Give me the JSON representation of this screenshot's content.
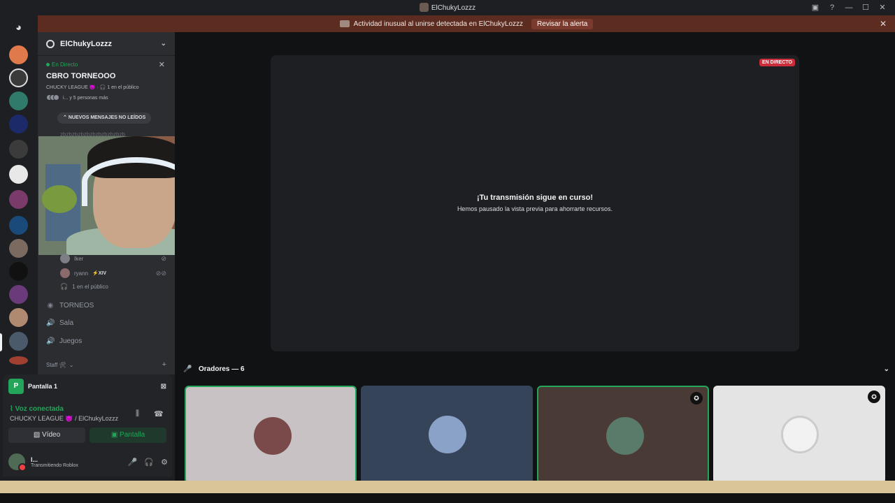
{
  "window": {
    "title": "ElChukyLozzz"
  },
  "alert": {
    "text": "Actividad inusual al unirse detectada en ElChukyLozzz",
    "button": "Revisar la alerta"
  },
  "server": {
    "name": "ElChukyLozzz"
  },
  "stage_card": {
    "live_label": "En Directo",
    "title": "CBRO TORNEOOO",
    "meta": "CHUCKY LEAGUE 😈 · 🎧 1 en el público",
    "people": "i... y 5 personas más"
  },
  "unread": {
    "label": "NUEVOS MENSAJES NO LEÍDOS"
  },
  "ghost_message": "zbzbzbzbzbzbzbzbzbzbzb",
  "voice_users": [
    {
      "name": "Iker"
    },
    {
      "name": "ryann",
      "tag": "⚡XIV"
    }
  ],
  "audience_line": "1 en el público",
  "channels": [
    {
      "name": "TORNEOS",
      "icon": "stage-icon"
    },
    {
      "name": "Sala",
      "icon": "speaker-icon"
    },
    {
      "name": "Juegos",
      "icon": "speaker-icon"
    }
  ],
  "category": {
    "name": "Staff 🛠"
  },
  "voice_panel": {
    "screen_title": "Pantalla 1",
    "status": "Voz conectada",
    "location": "CHUCKY LEAGUE 😈 / ElChukyLozzz",
    "video_button": "Vídeo",
    "screen_button": "Pantalla"
  },
  "self_user": {
    "name": "l...",
    "status": "Transmitiendo Roblox"
  },
  "stage": {
    "live_badge": "EN DIRECTO",
    "paused_title": "¡Tu transmisión sigue en curso!",
    "paused_subtitle": "Hemos pausado la vista previa para ahorrarte recursos."
  },
  "speakers": {
    "label": "Oradores — 6"
  },
  "colors": {
    "green": "#23a55a",
    "live_red": "#c92e3a",
    "alert_bg": "#5d2c21"
  }
}
